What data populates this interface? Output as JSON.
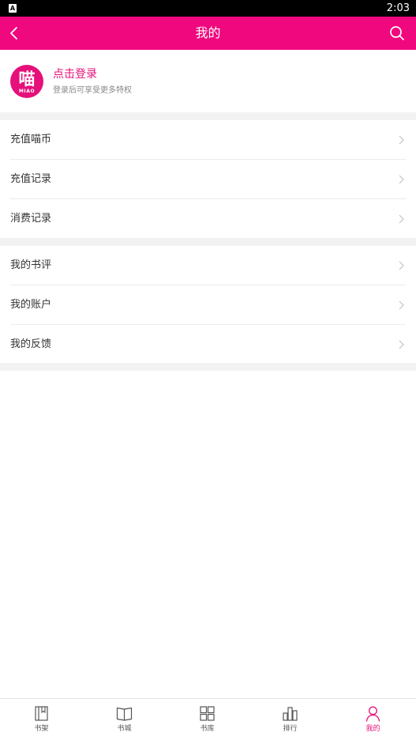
{
  "status_bar": {
    "notification_icon": "A",
    "time": "2:03"
  },
  "header": {
    "title": "我的",
    "back_icon": "chevron-left-icon",
    "search_icon": "search-icon"
  },
  "profile": {
    "avatar_text": "喵",
    "avatar_caption": "MIAO",
    "login_label": "点击登录",
    "login_hint": "登录后可享受更多特权"
  },
  "menu_group_1": [
    {
      "label": "充值喵币"
    },
    {
      "label": "充值记录"
    },
    {
      "label": "消费记录"
    }
  ],
  "menu_group_2": [
    {
      "label": "我的书评"
    },
    {
      "label": "我的账户"
    },
    {
      "label": "我的反馈"
    }
  ],
  "tab_bar": {
    "tabs": [
      {
        "label": "书架",
        "icon": "bookshelf-icon"
      },
      {
        "label": "书城",
        "icon": "open-book-icon"
      },
      {
        "label": "书库",
        "icon": "grid-icon"
      },
      {
        "label": "排行",
        "icon": "ranking-icon"
      },
      {
        "label": "我的",
        "icon": "person-icon",
        "active": true
      }
    ]
  },
  "colors": {
    "accent": "#f0087e",
    "brand_text": "#e5107a",
    "background_gap": "#f2f2f2"
  }
}
